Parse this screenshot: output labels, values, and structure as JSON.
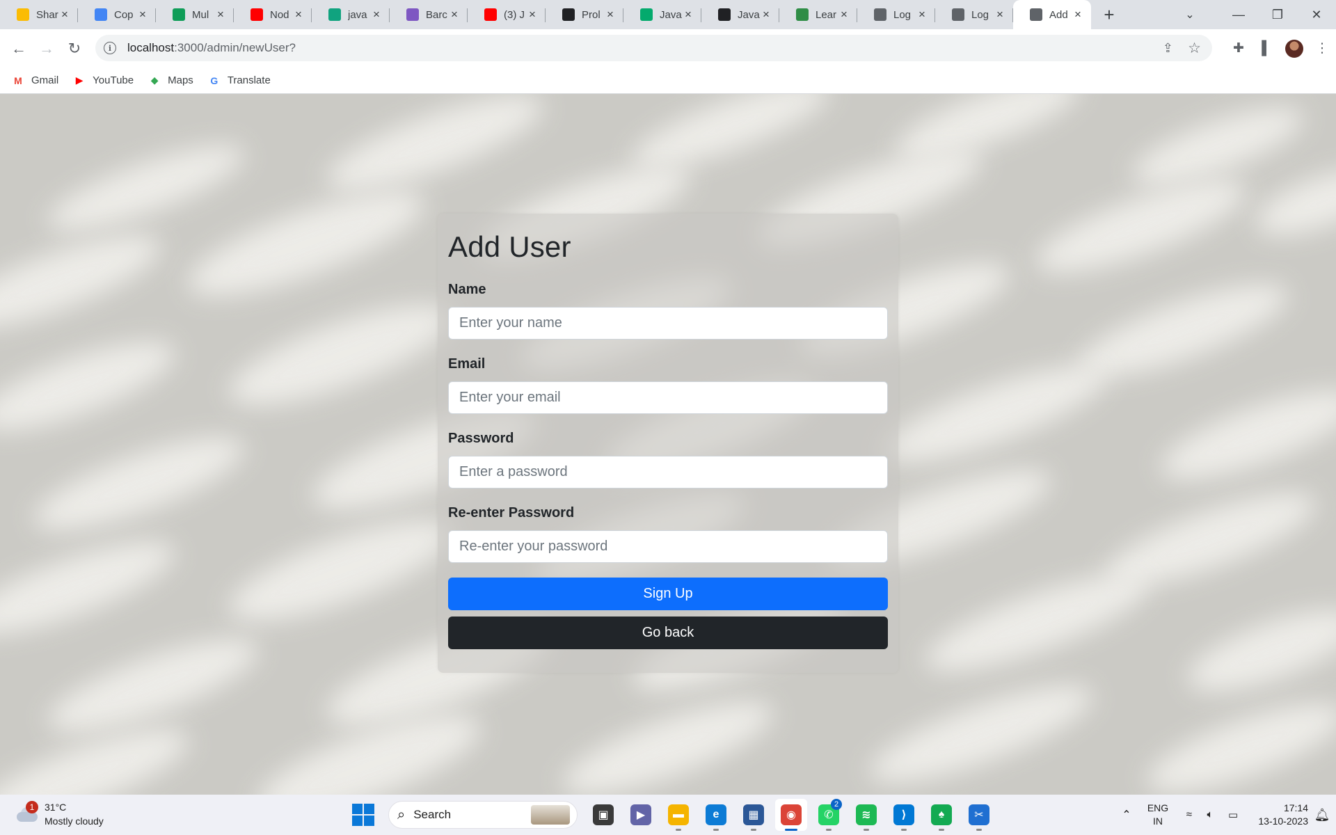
{
  "browser": {
    "tabs": [
      {
        "title": "Shar",
        "icon": "google-drive-icon",
        "color": "#fbbc04"
      },
      {
        "title": "Cop",
        "icon": "google-docs-icon",
        "color": "#4285f4"
      },
      {
        "title": "Mul",
        "icon": "google-sheets-icon",
        "color": "#0f9d58"
      },
      {
        "title": "Nod",
        "icon": "youtube-icon",
        "color": "#ff0000"
      },
      {
        "title": "java",
        "icon": "chatgpt-icon",
        "color": "#10a37f"
      },
      {
        "title": "Barc",
        "icon": "bard-icon",
        "color": "#7e57c2"
      },
      {
        "title": "(3) J",
        "icon": "youtube-icon",
        "color": "#ff0000"
      },
      {
        "title": "Prol",
        "icon": "leetcode-icon",
        "color": "#202124"
      },
      {
        "title": "Java",
        "icon": "w3schools-icon",
        "color": "#04aa6d"
      },
      {
        "title": "Java",
        "icon": "medium-icon",
        "color": "#202124"
      },
      {
        "title": "Lear",
        "icon": "geeksforgeeks-icon",
        "color": "#2f8d46"
      },
      {
        "title": "Log",
        "icon": "globe-icon",
        "color": "#5f6368"
      },
      {
        "title": "Log",
        "icon": "globe-icon",
        "color": "#5f6368"
      },
      {
        "title": "Add",
        "icon": "globe-icon",
        "color": "#5f6368",
        "active": true
      }
    ],
    "address": {
      "host": "localhost",
      "path": ":3000/admin/newUser?"
    },
    "bookmarks": [
      {
        "label": "Gmail",
        "icon": "gmail-icon",
        "glyph": "M",
        "color": "#ea4335"
      },
      {
        "label": "YouTube",
        "icon": "youtube-icon",
        "glyph": "▶",
        "color": "#ff0000"
      },
      {
        "label": "Maps",
        "icon": "maps-icon",
        "glyph": "◆",
        "color": "#34a853"
      },
      {
        "label": "Translate",
        "icon": "translate-icon",
        "glyph": "G",
        "color": "#4285f4"
      }
    ]
  },
  "form": {
    "title": "Add User",
    "fields": [
      {
        "label": "Name",
        "placeholder": "Enter your name",
        "value": ""
      },
      {
        "label": "Email",
        "placeholder": "Enter your email",
        "value": ""
      },
      {
        "label": "Password",
        "placeholder": "Enter a password",
        "value": ""
      },
      {
        "label": "Re-enter Password",
        "placeholder": "Re-enter your password",
        "value": ""
      }
    ],
    "submit_label": "Sign Up",
    "back_label": "Go back",
    "colors": {
      "primary": "#0d6efd",
      "dark": "#212529"
    }
  },
  "taskbar": {
    "weather": {
      "temp": "31°C",
      "condition": "Mostly cloudy",
      "badge": "1"
    },
    "search_placeholder": "Search",
    "apps": [
      {
        "name": "task-view",
        "color": "#3a3a3a",
        "glyph": "▣"
      },
      {
        "name": "teams",
        "color": "#6264a7",
        "glyph": "▶"
      },
      {
        "name": "file-explorer",
        "color": "#f5b400",
        "glyph": "▬"
      },
      {
        "name": "edge",
        "color": "#0c7bd5",
        "glyph": "e"
      },
      {
        "name": "microsoft-store",
        "color": "#2b5797",
        "glyph": "▦"
      },
      {
        "name": "chrome",
        "color": "#db4437",
        "glyph": "◉",
        "active": true
      },
      {
        "name": "whatsapp",
        "color": "#25d366",
        "glyph": "✆",
        "badge": "2"
      },
      {
        "name": "spotify",
        "color": "#1db954",
        "glyph": "≋"
      },
      {
        "name": "vscode",
        "color": "#0078d4",
        "glyph": "⟩"
      },
      {
        "name": "mongodb-compass",
        "color": "#13aa52",
        "glyph": "♠"
      },
      {
        "name": "snipping-tool",
        "color": "#1f6fd1",
        "glyph": "✂"
      }
    ],
    "lang": {
      "line1": "ENG",
      "line2": "IN"
    },
    "time": "17:14",
    "date": "13-10-2023"
  }
}
